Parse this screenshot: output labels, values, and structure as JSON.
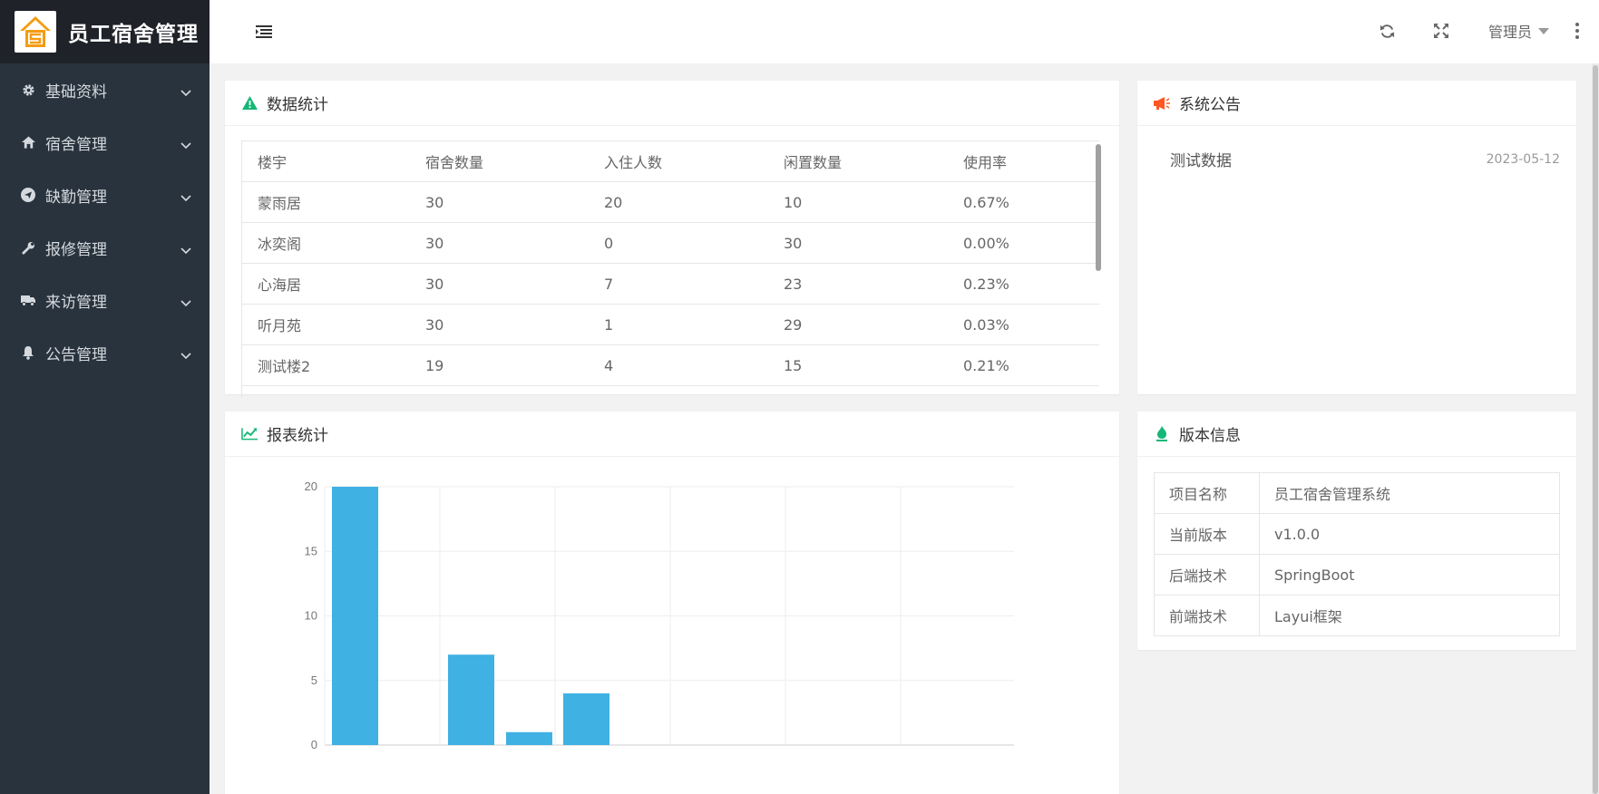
{
  "app": {
    "title": "员工宿舍管理"
  },
  "sidebar": {
    "items": [
      {
        "label": "基础资料",
        "icon": "gear-icon"
      },
      {
        "label": "宿舍管理",
        "icon": "home-icon"
      },
      {
        "label": "缺勤管理",
        "icon": "send-icon"
      },
      {
        "label": "报修管理",
        "icon": "wrench-icon"
      },
      {
        "label": "来访管理",
        "icon": "truck-icon"
      },
      {
        "label": "公告管理",
        "icon": "bell-icon"
      }
    ]
  },
  "header": {
    "user": "管理员"
  },
  "stats": {
    "title": "数据统计",
    "columns": [
      "楼宇",
      "宿舍数量",
      "入住人数",
      "闲置数量",
      "使用率"
    ],
    "rows": [
      [
        "蒙雨居",
        "30",
        "20",
        "10",
        "0.67%"
      ],
      [
        "冰奕阁",
        "30",
        "0",
        "30",
        "0.00%"
      ],
      [
        "心海居",
        "30",
        "7",
        "23",
        "0.23%"
      ],
      [
        "听月苑",
        "30",
        "1",
        "29",
        "0.03%"
      ],
      [
        "测试楼2",
        "19",
        "4",
        "15",
        "0.21%"
      ]
    ]
  },
  "notice": {
    "title": "系统公告",
    "items": [
      {
        "title": "测试数据",
        "date": "2023-05-12"
      }
    ]
  },
  "report": {
    "title": "报表统计"
  },
  "version": {
    "title": "版本信息",
    "rows": [
      {
        "key": "项目名称",
        "value": "员工宿舍管理系统"
      },
      {
        "key": "当前版本",
        "value": "v1.0.0"
      },
      {
        "key": "后端技术",
        "value": "SpringBoot"
      },
      {
        "key": "前端技术",
        "value": "Layui框架"
      }
    ]
  },
  "colors": {
    "sidebar": "#28333e",
    "logo_bg": "#20222a",
    "bar": "#3fb1e3",
    "accent": "#16b777",
    "notice_icon": "#ff5722"
  },
  "chart_data": {
    "type": "bar",
    "categories": [
      "",
      "",
      "",
      "",
      "",
      ""
    ],
    "values": [
      20,
      0,
      7,
      1,
      4,
      0
    ],
    "title": "",
    "xlabel": "",
    "ylabel": "",
    "ylim": [
      0,
      20
    ],
    "yticks": [
      "0",
      "5",
      "10",
      "15",
      "20"
    ],
    "grid": true
  }
}
